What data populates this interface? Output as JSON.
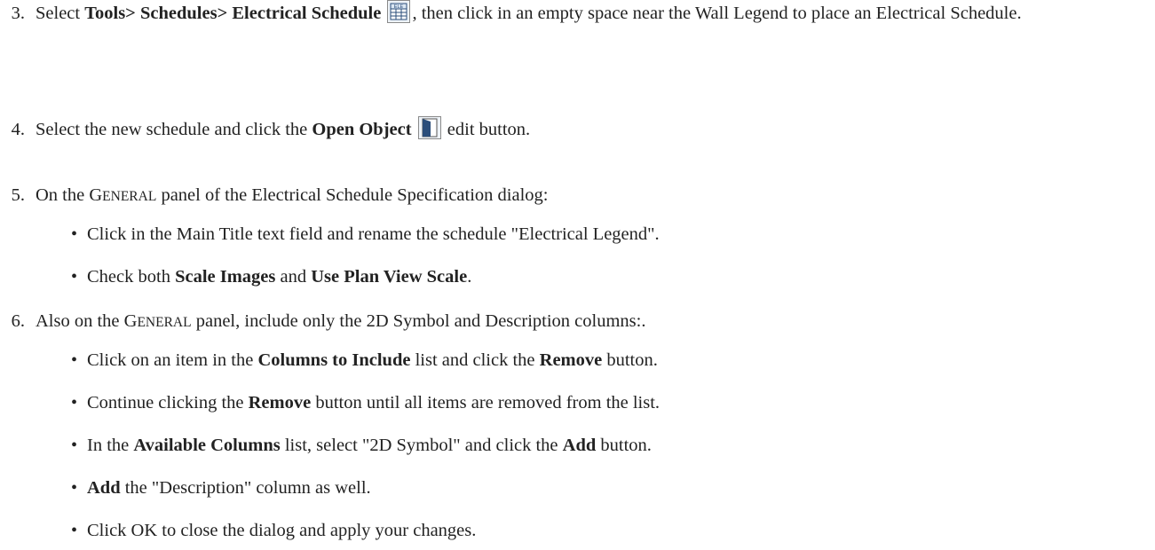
{
  "steps": [
    {
      "num": "3.",
      "parts": [
        {
          "t": "text",
          "v": "Select "
        },
        {
          "t": "bold",
          "v": "Tools> Schedules> Electrical Schedule"
        },
        {
          "t": "text",
          "v": " "
        },
        {
          "t": "icon",
          "name": "electrical-schedule-icon",
          "icon_label": "ELE"
        },
        {
          "t": "text",
          "v": ", then click in an empty space near the Wall Legend to place an Electrical Schedule."
        }
      ]
    },
    {
      "num": "4.",
      "parts": [
        {
          "t": "text",
          "v": "Select the new schedule and click the "
        },
        {
          "t": "bold",
          "v": "Open Object"
        },
        {
          "t": "text",
          "v": " "
        },
        {
          "t": "icon",
          "name": "open-object-icon",
          "icon_label": ""
        },
        {
          "t": "text",
          "v": " edit button."
        }
      ]
    },
    {
      "num": "5.",
      "parts": [
        {
          "t": "text",
          "v": "On the "
        },
        {
          "t": "smallcaps",
          "big": "G",
          "small": "ENERAL"
        },
        {
          "t": "text",
          "v": " panel of the Electrical Schedule Specification dialog:"
        }
      ],
      "bullets": [
        [
          {
            "t": "text",
            "v": "Click in the Main Title text field and rename the schedule \"Electrical Legend\"."
          }
        ],
        [
          {
            "t": "text",
            "v": "Check both "
          },
          {
            "t": "bold",
            "v": "Scale Images"
          },
          {
            "t": "text",
            "v": " and "
          },
          {
            "t": "bold",
            "v": "Use Plan View Scale"
          },
          {
            "t": "text",
            "v": "."
          }
        ]
      ]
    },
    {
      "num": "6.",
      "parts": [
        {
          "t": "text",
          "v": "Also on the "
        },
        {
          "t": "smallcaps",
          "big": "G",
          "small": "ENERAL"
        },
        {
          "t": "text",
          "v": " panel, include only the 2D Symbol and Description columns:."
        }
      ],
      "bullets": [
        [
          {
            "t": "text",
            "v": "Click on an item in the "
          },
          {
            "t": "bold",
            "v": "Columns to Include"
          },
          {
            "t": "text",
            "v": " list and click the "
          },
          {
            "t": "bold",
            "v": "Remove"
          },
          {
            "t": "text",
            "v": " button."
          }
        ],
        [
          {
            "t": "text",
            "v": "Continue clicking the "
          },
          {
            "t": "bold",
            "v": "Remove"
          },
          {
            "t": "text",
            "v": " button until all items are removed from the list."
          }
        ],
        [
          {
            "t": "text",
            "v": "In the "
          },
          {
            "t": "bold",
            "v": "Available Columns"
          },
          {
            "t": "text",
            "v": " list, select \"2D Symbol\" and click the "
          },
          {
            "t": "bold",
            "v": "Add"
          },
          {
            "t": "text",
            "v": " button."
          }
        ],
        [
          {
            "t": "bold",
            "v": "Add"
          },
          {
            "t": "text",
            "v": " the \"Description\" column as well."
          }
        ],
        [
          {
            "t": "text",
            "v": "Click OK to close the dialog and apply your changes."
          }
        ]
      ]
    }
  ],
  "bullet_glyph": "•",
  "colors": {
    "text": "#222222",
    "icon_border": "#8a8a8a",
    "icon_fill": "#eef3f8",
    "icon_accent": "#2a4d7a"
  }
}
